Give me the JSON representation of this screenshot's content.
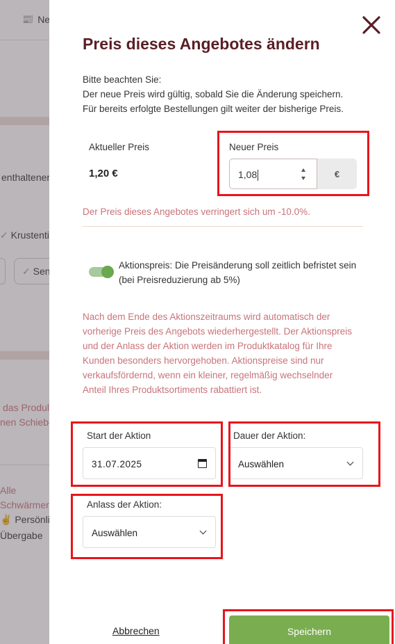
{
  "background": {
    "news_label": "Ne",
    "texts": {
      "enthaltene": "enthaltener",
      "krustentiere": "Krustentie",
      "sen": "Sen",
      "das_produkt": "das Produl",
      "schiebe": "nen Schiebe",
      "alle": "Alle",
      "schwaermerei": "Schwärmere",
      "persoenlich": "Persönlic",
      "uebergabe": "Übergabe"
    }
  },
  "modal": {
    "title": "Preis dieses Angebotes ändern",
    "notice_line1": "Bitte beachten Sie:",
    "notice_line2": "Der neue Preis wird gültig, sobald Sie die Änderung speichern.",
    "notice_line3": "Für bereits erfolgte Bestellungen gilt weiter der bisherige Preis.",
    "current_price_label": "Aktueller Preis",
    "current_price_value": "1,20 €",
    "new_price_label": "Neuer Preis",
    "new_price_value": "1,08",
    "currency": "€",
    "change_info": "Der Preis dieses Angebotes verringert sich um -10.0%.",
    "promo_toggle_on": true,
    "promo_toggle_label": "Aktionspreis: Die Preisänderung soll zeitlich befristet sein (bei Preisreduzierung ab 5%)",
    "promo_info": "Nach dem Ende des Aktionszeitraums wird automatisch der vorherige Preis des Angebots wiederhergestellt. Der Aktionspreis und der Anlass der Aktion werden im Produktkatalog für Ihre Kunden besonders hervorgehoben. Aktionspreise sind nur verkaufsfördernd, wenn ein kleiner, regelmäßig wechselnder Anteil Ihres Produktsortiments rabattiert ist.",
    "start_label": "Start der Aktion",
    "start_value": "31.07.2025",
    "duration_label": "Dauer der Aktion:",
    "duration_value": "Auswählen",
    "reason_label": "Anlass der Aktion:",
    "reason_value": "Auswählen",
    "cancel_label": "Abbrechen",
    "save_label": "Speichern"
  },
  "colors": {
    "title": "#5a1e26",
    "info_text": "#c8737a",
    "save_button": "#7aad4f",
    "toggle_on": "#6aa84f",
    "highlight": "#e8141b"
  }
}
